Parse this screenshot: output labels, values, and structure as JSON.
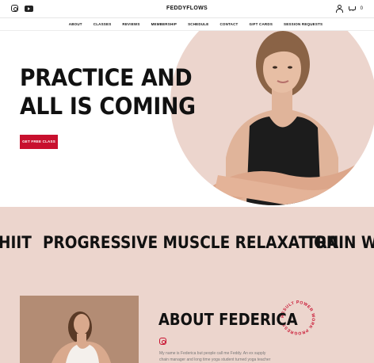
{
  "header": {
    "brand": "FEDDYFLOWS",
    "cart_count": "0"
  },
  "nav": {
    "items": [
      "ABOUT",
      "CLASSES",
      "REVIEWS",
      "MEMBERSHIP",
      "SCHEDULE",
      "CONTACT",
      "GIFT CARDS",
      "SESSION REQUESTS"
    ]
  },
  "hero": {
    "title_line1": "PRACTICE AND",
    "title_line2": "ALL IS COMING",
    "cta_label": "GET FREE CLASS"
  },
  "marquee": {
    "items": [
      "HIIT",
      "PROGRESSIVE MUSCLE RELAXATION",
      "TRAIN WIT"
    ]
  },
  "about": {
    "title": "ABOUT FEDERICA",
    "text_line1": "My name is Federica but people call me Feddy. An ex supply",
    "text_line2": "chain manager and long time yoga student turned yoga teacher",
    "badge_text": "RESULT POWER WORK PROGRESS"
  },
  "colors": {
    "accent": "#c8102e",
    "pink_bg": "#ecd5cd"
  }
}
